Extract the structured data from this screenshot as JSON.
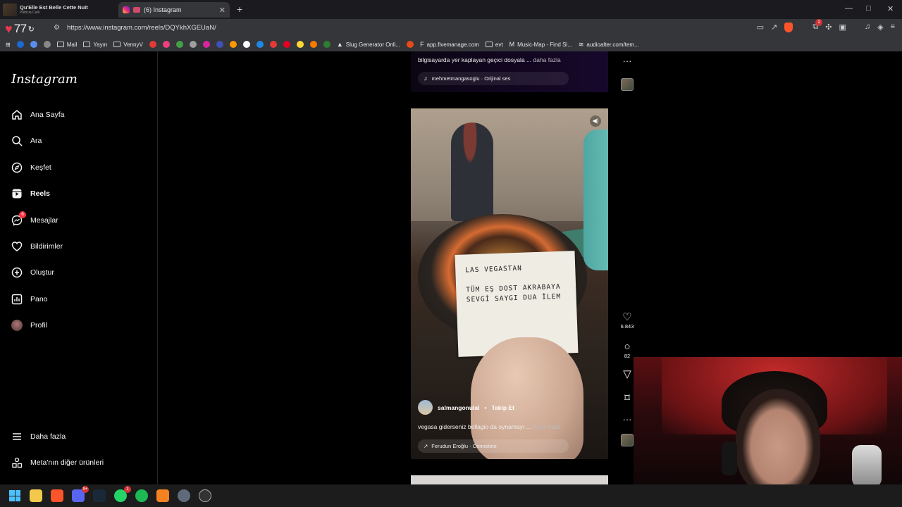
{
  "browser": {
    "tabs": [
      {
        "title": "Qu'Elle Est Belle Cette Nuit",
        "subtitle": "Patricia Carli",
        "active": false
      },
      {
        "title": "(6) Instagram",
        "active": true
      }
    ],
    "new_tab": "+",
    "window_controls": [
      "—",
      "□",
      "✕"
    ],
    "weather_temp": "77",
    "url": "https://www.instagram.com/reels/DQYkhXGEUaN/",
    "bookmarks": [
      "Mail",
      "Yayın",
      "VennyV",
      "Slug Generator Onli...",
      "app.fivemanage.com",
      "evt",
      "Music-Map - Find Si...",
      "audioalter.com/tem..."
    ],
    "extensions_badge": "2"
  },
  "sidebar": {
    "logo": "Instagram",
    "items": [
      {
        "label": "Ana Sayfa",
        "icon": "home-icon"
      },
      {
        "label": "Ara",
        "icon": "search-icon"
      },
      {
        "label": "Keşfet",
        "icon": "compass-icon"
      },
      {
        "label": "Reels",
        "icon": "reels-icon",
        "active": true
      },
      {
        "label": "Mesajlar",
        "icon": "messenger-icon",
        "badge": "6"
      },
      {
        "label": "Bildirimler",
        "icon": "heart-icon"
      },
      {
        "label": "Oluştur",
        "icon": "plus-square-icon"
      },
      {
        "label": "Pano",
        "icon": "dashboard-icon"
      },
      {
        "label": "Profil",
        "icon": "avatar"
      }
    ],
    "bottom": [
      {
        "label": "Daha fazla",
        "icon": "menu-icon"
      },
      {
        "label": "Meta'nın diğer ürünleri",
        "icon": "grid-icon"
      }
    ]
  },
  "prev_reel": {
    "caption": "bilgisayarda yer kaplayan geçici dosyala ...",
    "more": "daha fazla",
    "audio": "mehmetmangasoglu · Orijinal ses"
  },
  "reel": {
    "note_line1": "LAS VEGASTAN",
    "note_line2": "TÜM EŞ DOST AKRABAYA",
    "note_line3": "SEVGİ SAYGI DUA İLEM",
    "username": "salmangonulal",
    "separator": "•",
    "follow": "Takip Et",
    "caption": "vegasa giderseniz bellagio da oynamayı ...",
    "more": "daha fazla",
    "audio": "Ferudun Eroğlu · Cennetine",
    "likes": "6.843",
    "comments": "82"
  },
  "taskbar": {
    "discord_badge": "9+",
    "whatsapp_badge": "1"
  },
  "colors": {
    "accent_red": "#ff3040",
    "page_bg": "#000000",
    "chrome_bg": "#35363a"
  }
}
